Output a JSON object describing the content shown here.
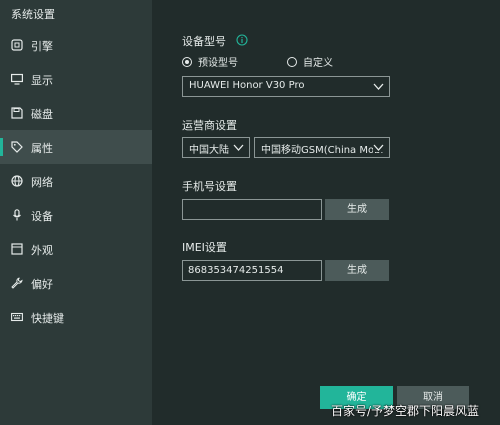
{
  "window": {
    "title": "系统设置"
  },
  "sidebar": {
    "items": [
      {
        "label": "引擎",
        "icon": "engine-icon",
        "active": false
      },
      {
        "label": "显示",
        "icon": "monitor-icon",
        "active": false
      },
      {
        "label": "磁盘",
        "icon": "disk-icon",
        "active": false
      },
      {
        "label": "属性",
        "icon": "tag-icon",
        "active": true
      },
      {
        "label": "网络",
        "icon": "globe-icon",
        "active": false
      },
      {
        "label": "设备",
        "icon": "microphone-icon",
        "active": false
      },
      {
        "label": "外观",
        "icon": "window-icon",
        "active": false
      },
      {
        "label": "偏好",
        "icon": "wrench-icon",
        "active": false
      },
      {
        "label": "快捷键",
        "icon": "keyboard-icon",
        "active": false
      }
    ]
  },
  "device_model": {
    "title": "设备型号",
    "info_icon": "info-icon",
    "radio_preset": "预设型号",
    "radio_custom": "自定义",
    "selected_radio": "preset",
    "model_value": "HUAWEI Honor V30 Pro"
  },
  "carrier": {
    "title": "运营商设置",
    "region_value": "中国大陆",
    "carrier_value": "中国移动GSM(China Mobi"
  },
  "phone": {
    "title": "手机号设置",
    "value": "",
    "generate_label": "生成"
  },
  "imei": {
    "title": "IMEI设置",
    "value": "868353474251554",
    "generate_label": "生成"
  },
  "footer": {
    "ok_label": "确定",
    "cancel_label": "取消"
  },
  "watermark": {
    "text": "百家号/予梦空郡下阳晨风蓝"
  },
  "colors": {
    "accent": "#22b59a",
    "sidebar_bg": "#2d3a39",
    "main_bg": "#212c2b",
    "button_bg": "#4c5b5a"
  }
}
